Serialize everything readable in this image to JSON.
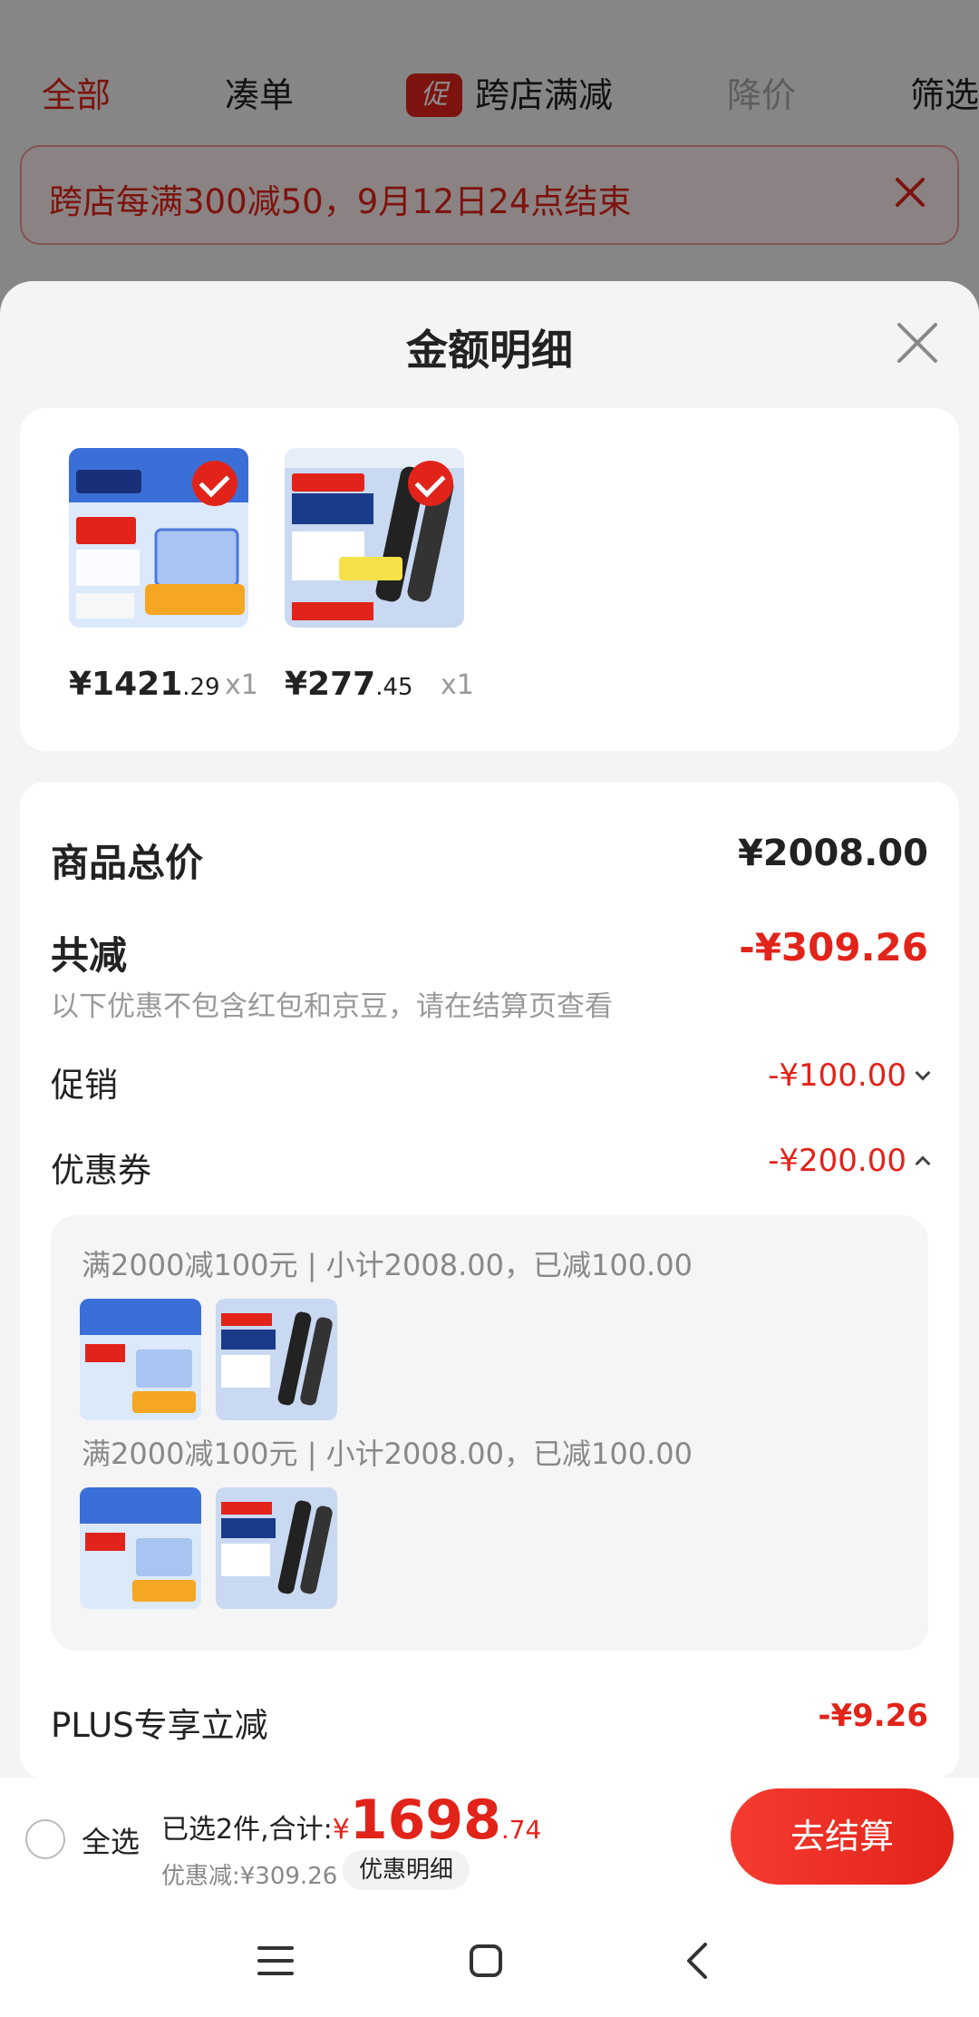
{
  "background": {
    "tabs": [
      {
        "label": "全部"
      },
      {
        "label": "凑单"
      },
      {
        "label": "跨店满减",
        "badge": "促"
      },
      {
        "label": "降价"
      },
      {
        "label": "筛选"
      }
    ],
    "notice": "跨店每满300减50，9月12日24点结束"
  },
  "sheet": {
    "title": "金额明细",
    "products": [
      {
        "price_int": "¥1421",
        "price_dec": ".29",
        "qty": "x1"
      },
      {
        "price_int": "¥277",
        "price_dec": ".45",
        "qty": "x1"
      }
    ],
    "total_label": "商品总价",
    "total_value": "¥2008.00",
    "reduce_label": "共减",
    "reduce_value": "-¥309.26",
    "note": "以下优惠不包含红包和京豆，请在结算页查看",
    "promo_label": "促销",
    "promo_value": "-¥100.00",
    "coupon_label": "优惠券",
    "coupon_value": "-¥200.00",
    "coupon_lines": [
      "满2000减100元 | 小计2008.00，已减100.00",
      "满2000减100元 | 小计2008.00，已减100.00"
    ],
    "plus_label": "PLUS专享立减",
    "plus_value": "-¥9.26"
  },
  "bottom_bar": {
    "select_all": "全选",
    "selected_prefix": "已选2件,合计:",
    "currency": "¥",
    "total_int": "1698",
    "total_dec": ".74",
    "discount": "优惠减:¥309.26",
    "detail_button": "优惠明细",
    "checkout_button": "去结算"
  },
  "colors": {
    "accent": "#e2231a",
    "background": "#f4f4f4",
    "card": "#ffffff"
  },
  "icons": [
    "close-icon",
    "check-icon",
    "chevron-down-icon",
    "chevron-up-icon",
    "menu-icon",
    "home-icon",
    "back-icon"
  ]
}
